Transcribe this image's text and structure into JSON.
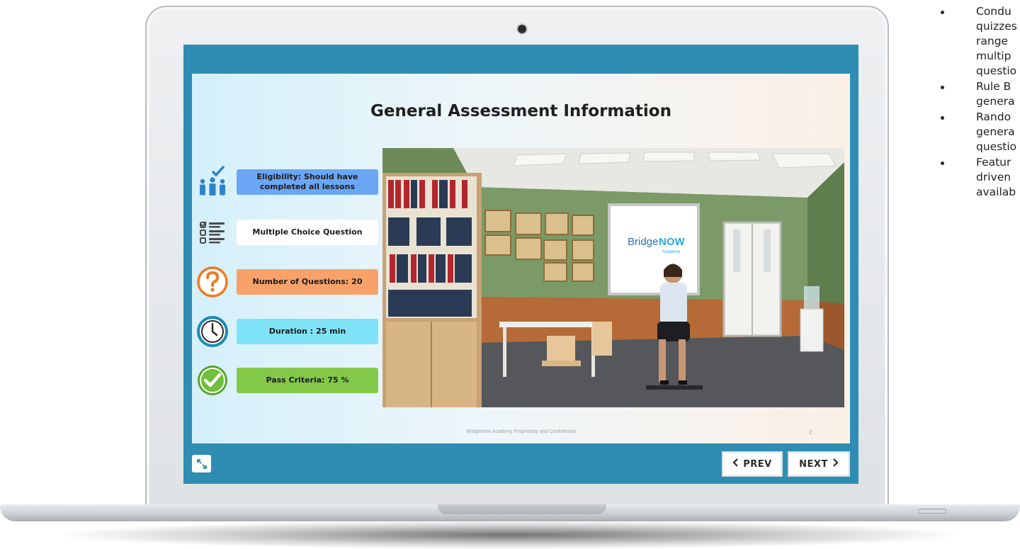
{
  "slide": {
    "title": "General Assessment Information",
    "footer": "BridgeNow Academy Proprietary and Confidential",
    "page_number": "2",
    "whiteboard_logo_a": "Bridge",
    "whiteboard_logo_b": "NOW",
    "whiteboard_logo_sub": "Academy",
    "info_items": [
      {
        "label": "Eligibility: Should have completed all lessons",
        "color": "#6aa6f3",
        "icon": "users-check-icon"
      },
      {
        "label": "Multiple Choice Question",
        "color": "#ffffff",
        "icon": "checklist-icon"
      },
      {
        "label": "Number of Questions: 20",
        "color": "#f8a26a",
        "icon": "question-circle-icon"
      },
      {
        "label": "Duration : 25 min",
        "color": "#7ee3f6",
        "icon": "clock-icon"
      },
      {
        "label": "Pass Criteria: 75 %",
        "color": "#84c84a",
        "icon": "check-circle-icon"
      }
    ]
  },
  "controls": {
    "prev_label": "PREV",
    "next_label": "NEXT"
  },
  "side_bullets": [
    "Condu\nquizzes\nrange\nmultip\nquestio",
    "Rule B\ngenera",
    "Rando\ngenera\nquestio",
    "Featur\ndriven\navailab"
  ],
  "colors": {
    "screen_frame": "#2f8db3",
    "accent_blue": "#2e83c8"
  }
}
